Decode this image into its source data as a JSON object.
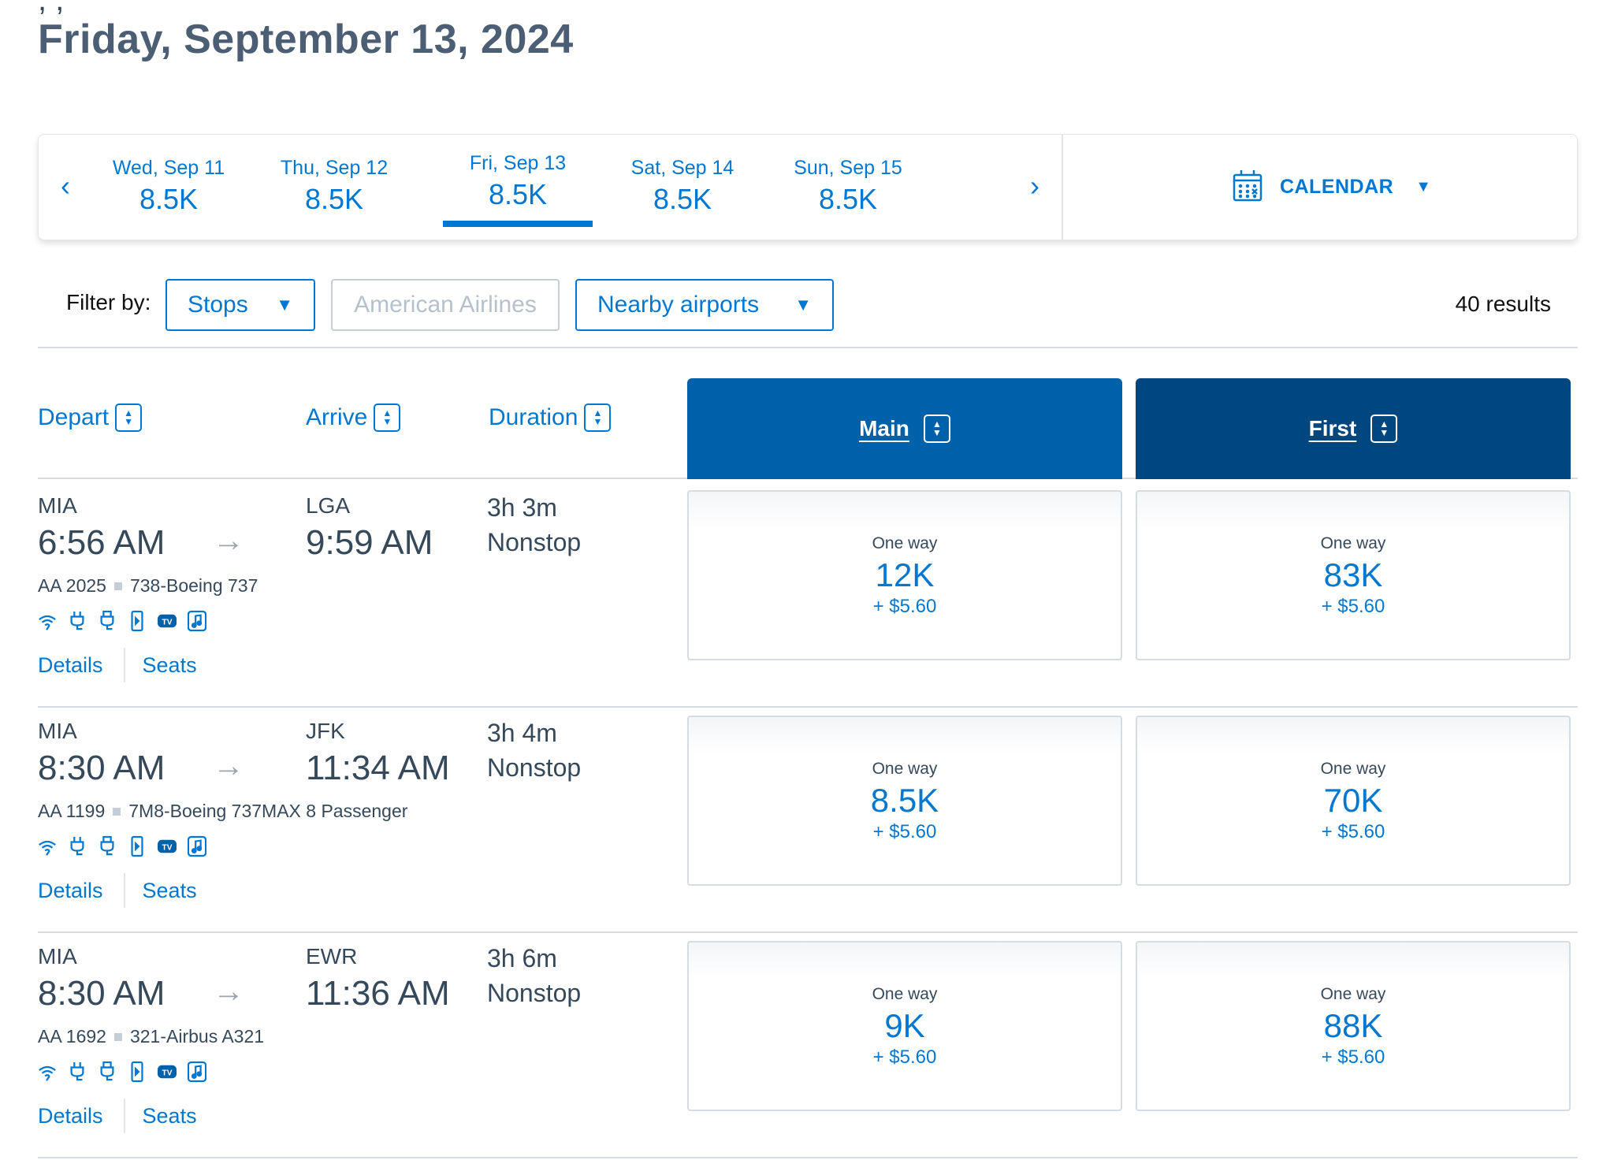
{
  "page": {
    "cutoff_text": ",                                  ,",
    "title": "Friday, September 13, 2024"
  },
  "date_strip": {
    "prev_label": "‹",
    "next_label": "›",
    "dates": [
      {
        "day": "Wed, Sep 11",
        "price": "8.5K",
        "selected": false
      },
      {
        "day": "Thu, Sep 12",
        "price": "8.5K",
        "selected": false
      },
      {
        "day": "Fri, Sep 13",
        "price": "8.5K",
        "selected": true
      },
      {
        "day": "Sat, Sep 14",
        "price": "8.5K",
        "selected": false
      },
      {
        "day": "Sun, Sep 15",
        "price": "8.5K",
        "selected": false
      }
    ],
    "calendar_label": "CALENDAR",
    "calendar_icon": "calendar-icon",
    "caret": "▼"
  },
  "filters": {
    "label": "Filter by:",
    "stops": "Stops",
    "airline": "American Airlines",
    "nearby": "Nearby airports",
    "caret": "▼",
    "results": "40 results"
  },
  "columns": {
    "depart": "Depart",
    "arrive": "Arrive",
    "duration": "Duration",
    "main": "Main",
    "first": "First"
  },
  "colors": {
    "accent": "#0078d2",
    "main_header": "#0061ab",
    "first_header": "#00467f",
    "text": "#36495a",
    "title": "#4b5e74"
  },
  "amenity_icons": [
    "wifi-icon",
    "power-outlet-icon",
    "usb-icon",
    "streaming-device-icon",
    "tv-icon",
    "music-icon"
  ],
  "flights": [
    {
      "origin": "MIA",
      "depart_time": "6:56 AM",
      "arrow": "→",
      "destination": "LGA",
      "arrive_time": "9:59 AM",
      "duration": "3h 3m",
      "stops": "Nonstop",
      "flight_number": "AA 2025",
      "aircraft": "738-Boeing 737",
      "details_label": "Details",
      "seats_label": "Seats",
      "main": {
        "label": "One way",
        "miles": "12K",
        "tax": "+ $5.60"
      },
      "first": {
        "label": "One way",
        "miles": "83K",
        "tax": "+ $5.60"
      }
    },
    {
      "origin": "MIA",
      "depart_time": "8:30 AM",
      "arrow": "→",
      "destination": "JFK",
      "arrive_time": "11:34 AM",
      "duration": "3h 4m",
      "stops": "Nonstop",
      "flight_number": "AA 1199",
      "aircraft": "7M8-Boeing 737MAX 8 Passenger",
      "details_label": "Details",
      "seats_label": "Seats",
      "main": {
        "label": "One way",
        "miles": "8.5K",
        "tax": "+ $5.60"
      },
      "first": {
        "label": "One way",
        "miles": "70K",
        "tax": "+ $5.60"
      }
    },
    {
      "origin": "MIA",
      "depart_time": "8:30 AM",
      "arrow": "→",
      "destination": "EWR",
      "arrive_time": "11:36 AM",
      "duration": "3h 6m",
      "stops": "Nonstop",
      "flight_number": "AA 1692",
      "aircraft": "321-Airbus A321",
      "details_label": "Details",
      "seats_label": "Seats",
      "main": {
        "label": "One way",
        "miles": "9K",
        "tax": "+ $5.60"
      },
      "first": {
        "label": "One way",
        "miles": "88K",
        "tax": "+ $5.60"
      }
    }
  ]
}
